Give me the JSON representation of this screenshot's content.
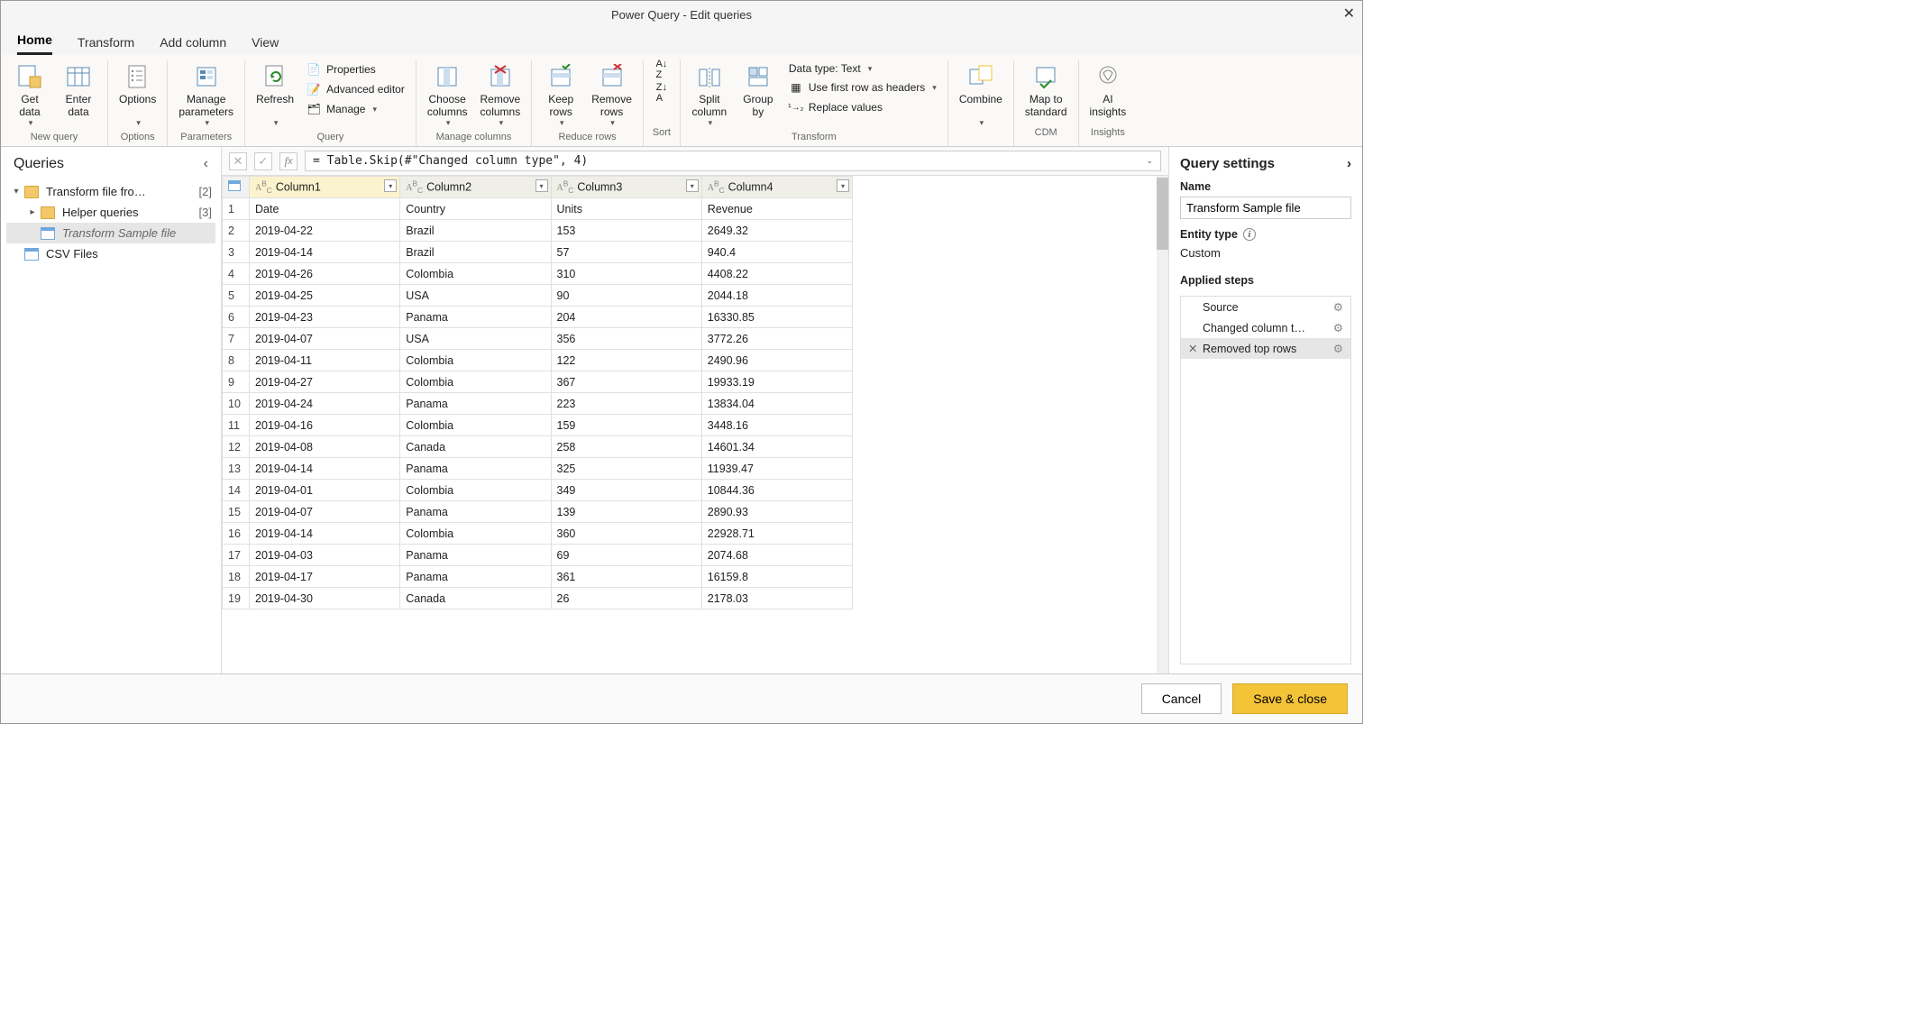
{
  "title": "Power Query - Edit queries",
  "tabs": [
    "Home",
    "Transform",
    "Add column",
    "View"
  ],
  "ribbon": {
    "new_query": {
      "label": "New query",
      "get_data": "Get\ndata",
      "enter_data": "Enter\ndata"
    },
    "options": {
      "label": "Options",
      "options": "Options"
    },
    "parameters": {
      "label": "Parameters",
      "manage": "Manage\nparameters"
    },
    "query": {
      "label": "Query",
      "refresh": "Refresh",
      "properties": "Properties",
      "advanced": "Advanced editor",
      "manage": "Manage"
    },
    "manage_cols": {
      "label": "Manage columns",
      "choose": "Choose\ncolumns",
      "remove": "Remove\ncolumns"
    },
    "reduce": {
      "label": "Reduce rows",
      "keep": "Keep\nrows",
      "remove": "Remove\nrows"
    },
    "sort": {
      "label": "Sort"
    },
    "transform": {
      "label": "Transform",
      "split": "Split\ncolumn",
      "group": "Group\nby",
      "datatype": "Data type: Text",
      "firstrow": "Use first row as headers",
      "replace": "Replace values"
    },
    "combine": {
      "label": "Combine",
      "combine": "Combine"
    },
    "cdm": {
      "label": "CDM",
      "map": "Map to\nstandard"
    },
    "insights": {
      "label": "Insights",
      "ai": "AI\ninsights"
    }
  },
  "queries_pane": {
    "title": "Queries",
    "items": [
      {
        "label": "Transform file fro…",
        "count": "[2]",
        "type": "folder",
        "indent": 0,
        "expanded": true
      },
      {
        "label": "Helper queries",
        "count": "[3]",
        "type": "folder",
        "indent": 1,
        "expanded": false
      },
      {
        "label": "Transform Sample file",
        "type": "table",
        "indent": 1,
        "selected": true,
        "italic": true
      },
      {
        "label": "CSV Files",
        "type": "table",
        "indent": 0
      }
    ]
  },
  "formula": "=  Table.Skip(#\"Changed column type\", 4)",
  "columns": [
    "Column1",
    "Column2",
    "Column3",
    "Column4"
  ],
  "rows": [
    [
      "Date",
      "Country",
      "Units",
      "Revenue"
    ],
    [
      "2019-04-22",
      "Brazil",
      "153",
      "2649.32"
    ],
    [
      "2019-04-14",
      "Brazil",
      "57",
      "940.4"
    ],
    [
      "2019-04-26",
      "Colombia",
      "310",
      "4408.22"
    ],
    [
      "2019-04-25",
      "USA",
      "90",
      "2044.18"
    ],
    [
      "2019-04-23",
      "Panama",
      "204",
      "16330.85"
    ],
    [
      "2019-04-07",
      "USA",
      "356",
      "3772.26"
    ],
    [
      "2019-04-11",
      "Colombia",
      "122",
      "2490.96"
    ],
    [
      "2019-04-27",
      "Colombia",
      "367",
      "19933.19"
    ],
    [
      "2019-04-24",
      "Panama",
      "223",
      "13834.04"
    ],
    [
      "2019-04-16",
      "Colombia",
      "159",
      "3448.16"
    ],
    [
      "2019-04-08",
      "Canada",
      "258",
      "14601.34"
    ],
    [
      "2019-04-14",
      "Panama",
      "325",
      "11939.47"
    ],
    [
      "2019-04-01",
      "Colombia",
      "349",
      "10844.36"
    ],
    [
      "2019-04-07",
      "Panama",
      "139",
      "2890.93"
    ],
    [
      "2019-04-14",
      "Colombia",
      "360",
      "22928.71"
    ],
    [
      "2019-04-03",
      "Panama",
      "69",
      "2074.68"
    ],
    [
      "2019-04-17",
      "Panama",
      "361",
      "16159.8"
    ],
    [
      "2019-04-30",
      "Canada",
      "26",
      "2178.03"
    ]
  ],
  "settings": {
    "title": "Query settings",
    "name_label": "Name",
    "name_value": "Transform Sample file",
    "entity_label": "Entity type",
    "entity_value": "Custom",
    "steps_label": "Applied steps",
    "steps": [
      {
        "label": "Source",
        "gear": true
      },
      {
        "label": "Changed column t…",
        "gear": true
      },
      {
        "label": "Removed top rows",
        "gear": true,
        "selected": true,
        "x": true
      }
    ]
  },
  "footer": {
    "cancel": "Cancel",
    "save": "Save & close"
  }
}
